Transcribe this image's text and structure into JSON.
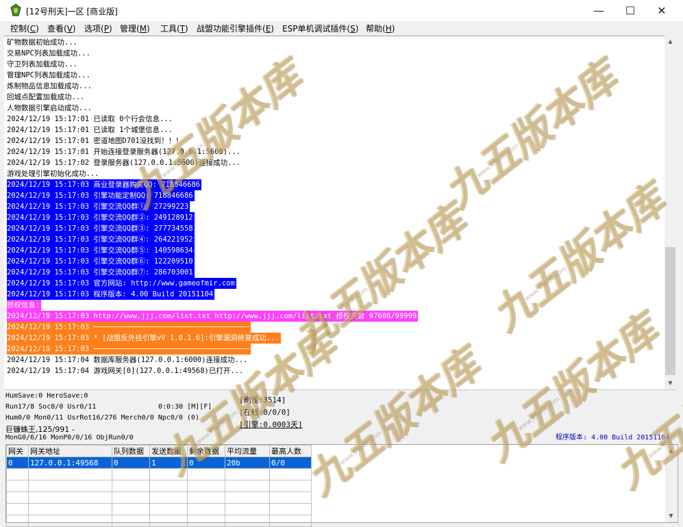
{
  "window": {
    "title": "[12号刑天]一区 [商业版]",
    "controls": [
      "—",
      "☐",
      "✕"
    ]
  },
  "menu": [
    {
      "label": "控制(",
      "key": "C",
      "tail": ")"
    },
    {
      "label": "查看(",
      "key": "V",
      "tail": ")"
    },
    {
      "label": "选项(",
      "key": "P",
      "tail": ")"
    },
    {
      "label": "管理(",
      "key": "M",
      "tail": ")"
    },
    {
      "label": "工具(",
      "key": "T",
      "tail": ")"
    },
    {
      "label": "战盟功能引擎插件(",
      "key": "E",
      "tail": ")"
    },
    {
      "label": "ESP单机调试插件(",
      "key": "S",
      "tail": ")"
    },
    {
      "label": "帮助(",
      "key": "H",
      "tail": ")"
    }
  ],
  "log": [
    {
      "text": "矿物数据初始成功...",
      "style": "normal"
    },
    {
      "text": "交易NPC列表加载成功...",
      "style": "normal"
    },
    {
      "text": "守卫列表加载成功...",
      "style": "normal"
    },
    {
      "text": "管理NPC列表加载成功...",
      "style": "normal"
    },
    {
      "text": "炼制物品信息加载成功...",
      "style": "normal"
    },
    {
      "text": "回城点配置加载成功...",
      "style": "normal"
    },
    {
      "text": "人物数据引擎启动成功...",
      "style": "normal"
    },
    {
      "text": "2024/12/19 15:17:01 已读取 0个行会信息...",
      "style": "normal"
    },
    {
      "text": "2024/12/19 15:17:01 已读取 1个城堡信息...",
      "style": "normal"
    },
    {
      "text": "2024/12/19 15:17:01 密道地图D701没找到！！！",
      "style": "normal"
    },
    {
      "text": "2024/12/19 15:17:01 开始连接登录服务器(127.0.0.1:5600)...",
      "style": "normal"
    },
    {
      "text": "2024/12/19 15:17:02 登录服务器(127.0.0.1:5600)连接成功...",
      "style": "normal"
    },
    {
      "text": "游戏处理引擎初始化成功...",
      "style": "normal"
    },
    {
      "text": "2024/12/19 15:17:03 商业登录器购买QQ: 718846686",
      "style": "blue"
    },
    {
      "text": "2024/12/19 15:17:03 引擎功能定制QQ: 718846686",
      "style": "blue"
    },
    {
      "text": "2024/12/19 15:17:03 引擎交流QQ群①: 27299223",
      "style": "blue"
    },
    {
      "text": "2024/12/19 15:17:03 引擎交流QQ群②: 249128912",
      "style": "blue"
    },
    {
      "text": "2024/12/19 15:17:03 引擎交流QQ群③: 277734558",
      "style": "blue"
    },
    {
      "text": "2024/12/19 15:17:03 引擎交流QQ群④: 264221952",
      "style": "blue"
    },
    {
      "text": "2024/12/19 15:17:03 引擎交流QQ群⑤: 140598634",
      "style": "blue"
    },
    {
      "text": "2024/12/19 15:17:03 引擎交流QQ群⑥: 122209510",
      "style": "blue"
    },
    {
      "text": "2024/12/19 15:17:03 引擎交流QQ群⑦: 286703001",
      "style": "blue"
    },
    {
      "text": "2024/12/19 15:17:03 官方网站: http://www.gameofmir.com",
      "style": "blue"
    },
    {
      "text": "2024/12/19 15:17:03 程序版本: 4.00 Build 20151104",
      "style": "blue"
    },
    {
      "text": "授权信息:",
      "style": "magenta"
    },
    {
      "text": "2024/12/19 15:17:03 http://www.jjj.com/list.txt http://www.jjj.com/list.txt 授权天数 97608/99999",
      "style": "magenta"
    },
    {
      "text": "2024/12/19 15:17:03 ────────────────────────────────────",
      "style": "orange"
    },
    {
      "text": "2024/12/19 15:17:03 * [战盟反外挂引擎vV 1.0.1.6]:引擎漏洞修复成功...",
      "style": "orange"
    },
    {
      "text": "2024/12/19 15:17:03 ────────────────────────────────────",
      "style": "orange"
    },
    {
      "text": "2024/12/19 15:17:04 数据库服务器(127.0.0.1:6000)连接成功...",
      "style": "normal"
    },
    {
      "text": "2024/12/19 15:17:04 游戏网关[0](127.0.0.1:49568)已打开...",
      "style": "normal"
    }
  ],
  "colors": {
    "blue": "#0000ff",
    "magenta": "#ff40ff",
    "orange": "#ff7f1a",
    "normal": "#000000"
  },
  "status": {
    "hum_save": "HumSave:0 HeroSave:0",
    "run": "Run17/8 Soc0/0 Usr0/11",
    "time": "0:0:30 [M][F]",
    "hum": "Hum0/0 Mon0/11 UsrRot16/276 Merch0/0 Npc0/0 (0)",
    "monster": "巨镰蛛王,125/991 -",
    "mon": "MonG0/6/16 MonP0/0/16 ObjRun0/0",
    "refresh": "[刷怪:3514]",
    "online": "[在线:0/0/0]",
    "engine": "[引擎:0.0003天]",
    "version": "程序版本: 4.00 Build 20151104"
  },
  "grid": {
    "headers": [
      "网关",
      "网关地址",
      "队列数据",
      "发送数据",
      "剩余数据",
      "平均流量",
      "最高人数"
    ],
    "rows": [
      [
        "0",
        "127.0.0.1:49568",
        "0",
        "1",
        "0",
        "20b",
        "0/0"
      ]
    ]
  },
  "watermark": {
    "text": "九五版本库",
    "sub": "www.95bbk.com"
  }
}
